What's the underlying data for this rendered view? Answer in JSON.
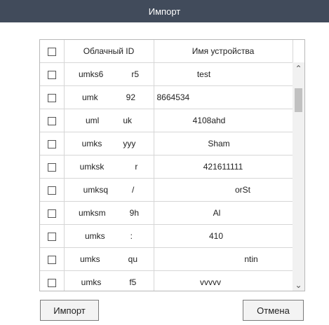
{
  "window": {
    "title": "Импорт"
  },
  "table": {
    "headers": {
      "cloud_id": "Облачный ID",
      "device_name": "Имя устройства"
    },
    "rows": [
      {
        "cloud_id_start": "umks6",
        "cloud_id_end": "r5",
        "name_start": "test",
        "name_end": ""
      },
      {
        "cloud_id_start": "umk",
        "cloud_id_end": "92",
        "name_start": "8664534",
        "name_end": ""
      },
      {
        "cloud_id_start": "uml",
        "cloud_id_end": "uk",
        "name_start": "4108ahd",
        "name_end": ""
      },
      {
        "cloud_id_start": "umks",
        "cloud_id_end": "yyy",
        "name_start": "Sham",
        "name_end": ""
      },
      {
        "cloud_id_start": "umksk",
        "cloud_id_end": "r",
        "name_start": "421611111",
        "name_end": ""
      },
      {
        "cloud_id_start": "umksq",
        "cloud_id_end": "/",
        "name_start": "",
        "name_end": "orSt"
      },
      {
        "cloud_id_start": "umksm",
        "cloud_id_end": "9h",
        "name_start": "Al",
        "name_end": ""
      },
      {
        "cloud_id_start": "umks",
        "cloud_id_end": ":",
        "name_start": "410",
        "name_end": ""
      },
      {
        "cloud_id_start": "umks",
        "cloud_id_end": "qu",
        "name_start": "",
        "name_end": "ntin"
      },
      {
        "cloud_id_start": "umks",
        "cloud_id_end": "f5",
        "name_start": "vvvvv",
        "name_end": ""
      }
    ]
  },
  "buttons": {
    "import": "Импорт",
    "cancel": "Отмена"
  },
  "icons": {
    "scroll_up": "chevron-up-icon",
    "scroll_down": "chevron-down-icon"
  }
}
